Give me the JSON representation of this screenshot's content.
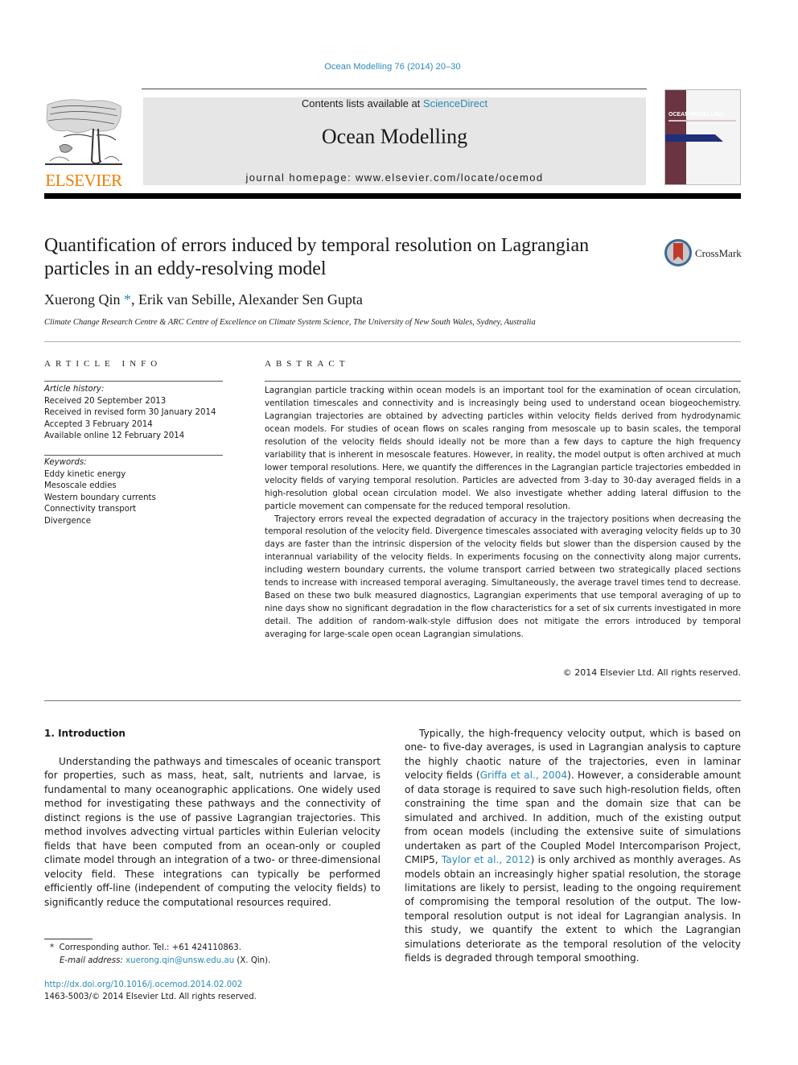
{
  "header": {
    "journal_ref": "Ocean Modelling 76 (2014) 20–30",
    "contents_prefix": "Contents lists available at ",
    "contents_link": "ScienceDirect",
    "journal_title": "Ocean Modelling",
    "homepage": "journal homepage: www.elsevier.com/locate/ocemod",
    "publisher_word": "ELSEVIER",
    "cover_title": "OCEAN MODELLING",
    "accent_color": "#2a8ab8",
    "publisher_color": "#f07c00"
  },
  "article": {
    "title": "Quantification of errors induced by temporal resolution on Lagrangian particles in an eddy-resolving model",
    "crossmark_label": "CrossMark",
    "authors": {
      "first": "Xuerong Qin",
      "first_mark": "*",
      "rest": ", Erik van Sebille, Alexander Sen Gupta"
    },
    "affiliation": "Climate Change Research Centre & ARC Centre of Excellence on Climate System Science, The University of New South Wales, Sydney, Australia"
  },
  "article_info": {
    "heading": "ARTICLE INFO",
    "history_label": "Article history:",
    "history": [
      "Received 20 September 2013",
      "Received in revised form 30 January 2014",
      "Accepted 3 February 2014",
      "Available online 12 February 2014"
    ],
    "keywords_label": "Keywords:",
    "keywords": [
      "Eddy kinetic energy",
      "Mesoscale eddies",
      "Western boundary currents",
      "Connectivity transport",
      "Divergence"
    ]
  },
  "abstract": {
    "heading": "ABSTRACT",
    "paragraphs": [
      "Lagrangian particle tracking within ocean models is an important tool for the examination of ocean circulation, ventilation timescales and connectivity and is increasingly being used to understand ocean biogeochemistry. Lagrangian trajectories are obtained by advecting particles within velocity fields derived from hydrodynamic ocean models. For studies of ocean flows on scales ranging from mesoscale up to basin scales, the temporal resolution of the velocity fields should ideally not be more than a few days to capture the high frequency variability that is inherent in mesoscale features. However, in reality, the model output is often archived at much lower temporal resolutions. Here, we quantify the differences in the Lagrangian particle trajectories embedded in velocity fields of varying temporal resolution. Particles are advected from 3-day to 30-day averaged fields in a high-resolution global ocean circulation model. We also investigate whether adding lateral diffusion to the particle movement can compensate for the reduced temporal resolution.",
      "Trajectory errors reveal the expected degradation of accuracy in the trajectory positions when decreasing the temporal resolution of the velocity field. Divergence timescales associated with averaging velocity fields up to 30 days are faster than the intrinsic dispersion of the velocity fields but slower than the dispersion caused by the interannual variability of the velocity fields. In experiments focusing on the connectivity along major currents, including western boundary currents, the volume transport carried between two strategically placed sections tends to increase with increased temporal averaging. Simultaneously, the average travel times tend to decrease. Based on these two bulk measured diagnostics, Lagrangian experiments that use temporal averaging of up to nine days show no significant degradation in the flow characteristics for a set of six currents investigated in more detail. The addition of random-walk-style diffusion does not mitigate the errors introduced by temporal averaging for large-scale open ocean Lagrangian simulations."
    ],
    "copyright": "© 2014 Elsevier Ltd. All rights reserved."
  },
  "body": {
    "section_heading": "1. Introduction",
    "left_paragraph": "Understanding the pathways and timescales of oceanic transport for properties, such as mass, heat, salt, nutrients and larvae, is fundamental to many oceanographic applications. One widely used method for investigating these pathways and the connectivity of distinct regions is the use of passive Lagrangian trajectories. This method involves advecting virtual particles within Eulerian velocity fields that have been computed from an ocean-only or coupled climate model through an integration of a two- or three-dimensional velocity field. These integrations can typically be performed efficiently off-line (independent of computing the velocity fields) to significantly reduce the computational resources required.",
    "right_paragraph": {
      "part1": "Typically, the high-frequency velocity output, which is based on one- to five-day averages, is used in Lagrangian analysis to capture the highly chaotic nature of the trajectories, even in laminar velocity fields (",
      "cite1": "Griffa et al., 2004",
      "part2": "). However, a considerable amount of data storage is required to save such high-resolution fields, often constraining the time span and the domain size that can be simulated and archived. In addition, much of the existing output from ocean models (including the extensive suite of simulations undertaken as part of the Coupled Model Intercomparison Project, CMIP5, ",
      "cite2": "Taylor et al., 2012",
      "part3": ") is only archived as monthly averages. As models obtain an increasingly higher spatial resolution, the storage limitations are likely to persist, leading to the ongoing requirement of compromising the temporal resolution of the output. The low-temporal resolution output is not ideal for Lagrangian analysis. In this study, we quantify the extent to which the Lagrangian simulations deteriorate as the temporal resolution of the velocity fields is degraded through temporal smoothing."
    }
  },
  "footnotes": {
    "marker": "*",
    "corresponding": "Corresponding author. Tel.: +61 424110863.",
    "email_label": "E-mail address: ",
    "email": "xuerong.qin@unsw.edu.au",
    "email_suffix": " (X. Qin).",
    "doi": "http://dx.doi.org/10.1016/j.ocemod.2014.02.002",
    "issn_line": "1463-5003/© 2014 Elsevier Ltd. All rights reserved."
  }
}
